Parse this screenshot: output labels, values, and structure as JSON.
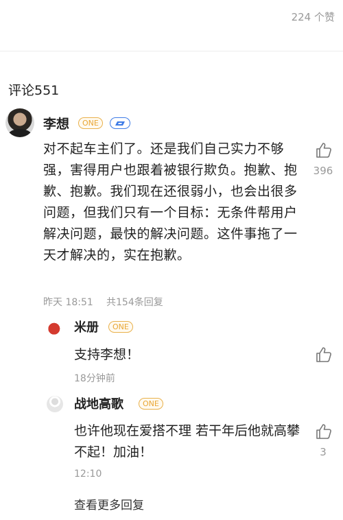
{
  "header": {
    "likes": "224 个赞"
  },
  "comments_section": {
    "title": "评论551"
  },
  "main_comment": {
    "username": "李想",
    "badge": "ONE",
    "text": "对不起车主们了。还是我们自己实力不够强，害得用户也跟着被银行欺负。抱歉、抱歉、抱歉。我们现在还很弱小，也会出很多问题，但我们只有一个目标：无条件帮用户解决问题，最快的解决问题。这件事拖了一天才解决的，实在抱歉。",
    "time": "昨天 18:51",
    "reply_count": "共154条回复",
    "likes": "396"
  },
  "replies": [
    {
      "username": "米册",
      "badge": "ONE",
      "text": "支持李想！",
      "time": "18分钟前",
      "likes": ""
    },
    {
      "username": "战地高歌",
      "badge": "ONE",
      "text": "也许他现在爱搭不理 若干年后他就高攀不起！加油！",
      "time": "12:10",
      "likes": "3"
    }
  ],
  "more_replies_label": "查看更多回复",
  "icons": {
    "like": "thumbs-up-icon",
    "car_badge": "car-badge-icon"
  },
  "colors": {
    "badge_gold": "#e9a634",
    "badge_blue": "#3d7be6",
    "meta_gray": "#999999"
  }
}
